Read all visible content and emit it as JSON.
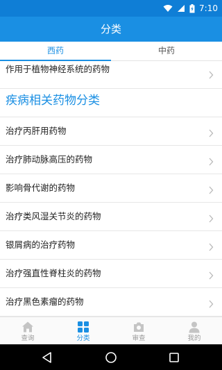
{
  "status_bar": {
    "time": "7:10"
  },
  "app_bar": {
    "title": "分类"
  },
  "tabs": [
    {
      "label": "西药",
      "active": true
    },
    {
      "label": "中药",
      "active": false
    }
  ],
  "list": {
    "top_item": "作用于植物神经系统的药物",
    "section_title": "疾病相关药物分类",
    "items": [
      "治疗丙肝用药物",
      "治疗肺动脉高压的药物",
      "影响骨代谢的药物",
      "治疗类风湿关节炎的药物",
      "银屑病的治疗药物",
      "治疗强直性脊柱炎的药物",
      "治疗黑色素瘤的药物"
    ]
  },
  "bottom_nav": [
    {
      "label": "查询",
      "icon": "home-icon",
      "active": false
    },
    {
      "label": "分类",
      "icon": "grid-icon",
      "active": true
    },
    {
      "label": "审查",
      "icon": "camera-icon",
      "active": false
    },
    {
      "label": "我的",
      "icon": "person-icon",
      "active": false
    }
  ],
  "colors": {
    "accent": "#1a8fe3",
    "status_bar": "#0f7ed6",
    "text": "#222222",
    "inactive": "#9a9a9a"
  }
}
